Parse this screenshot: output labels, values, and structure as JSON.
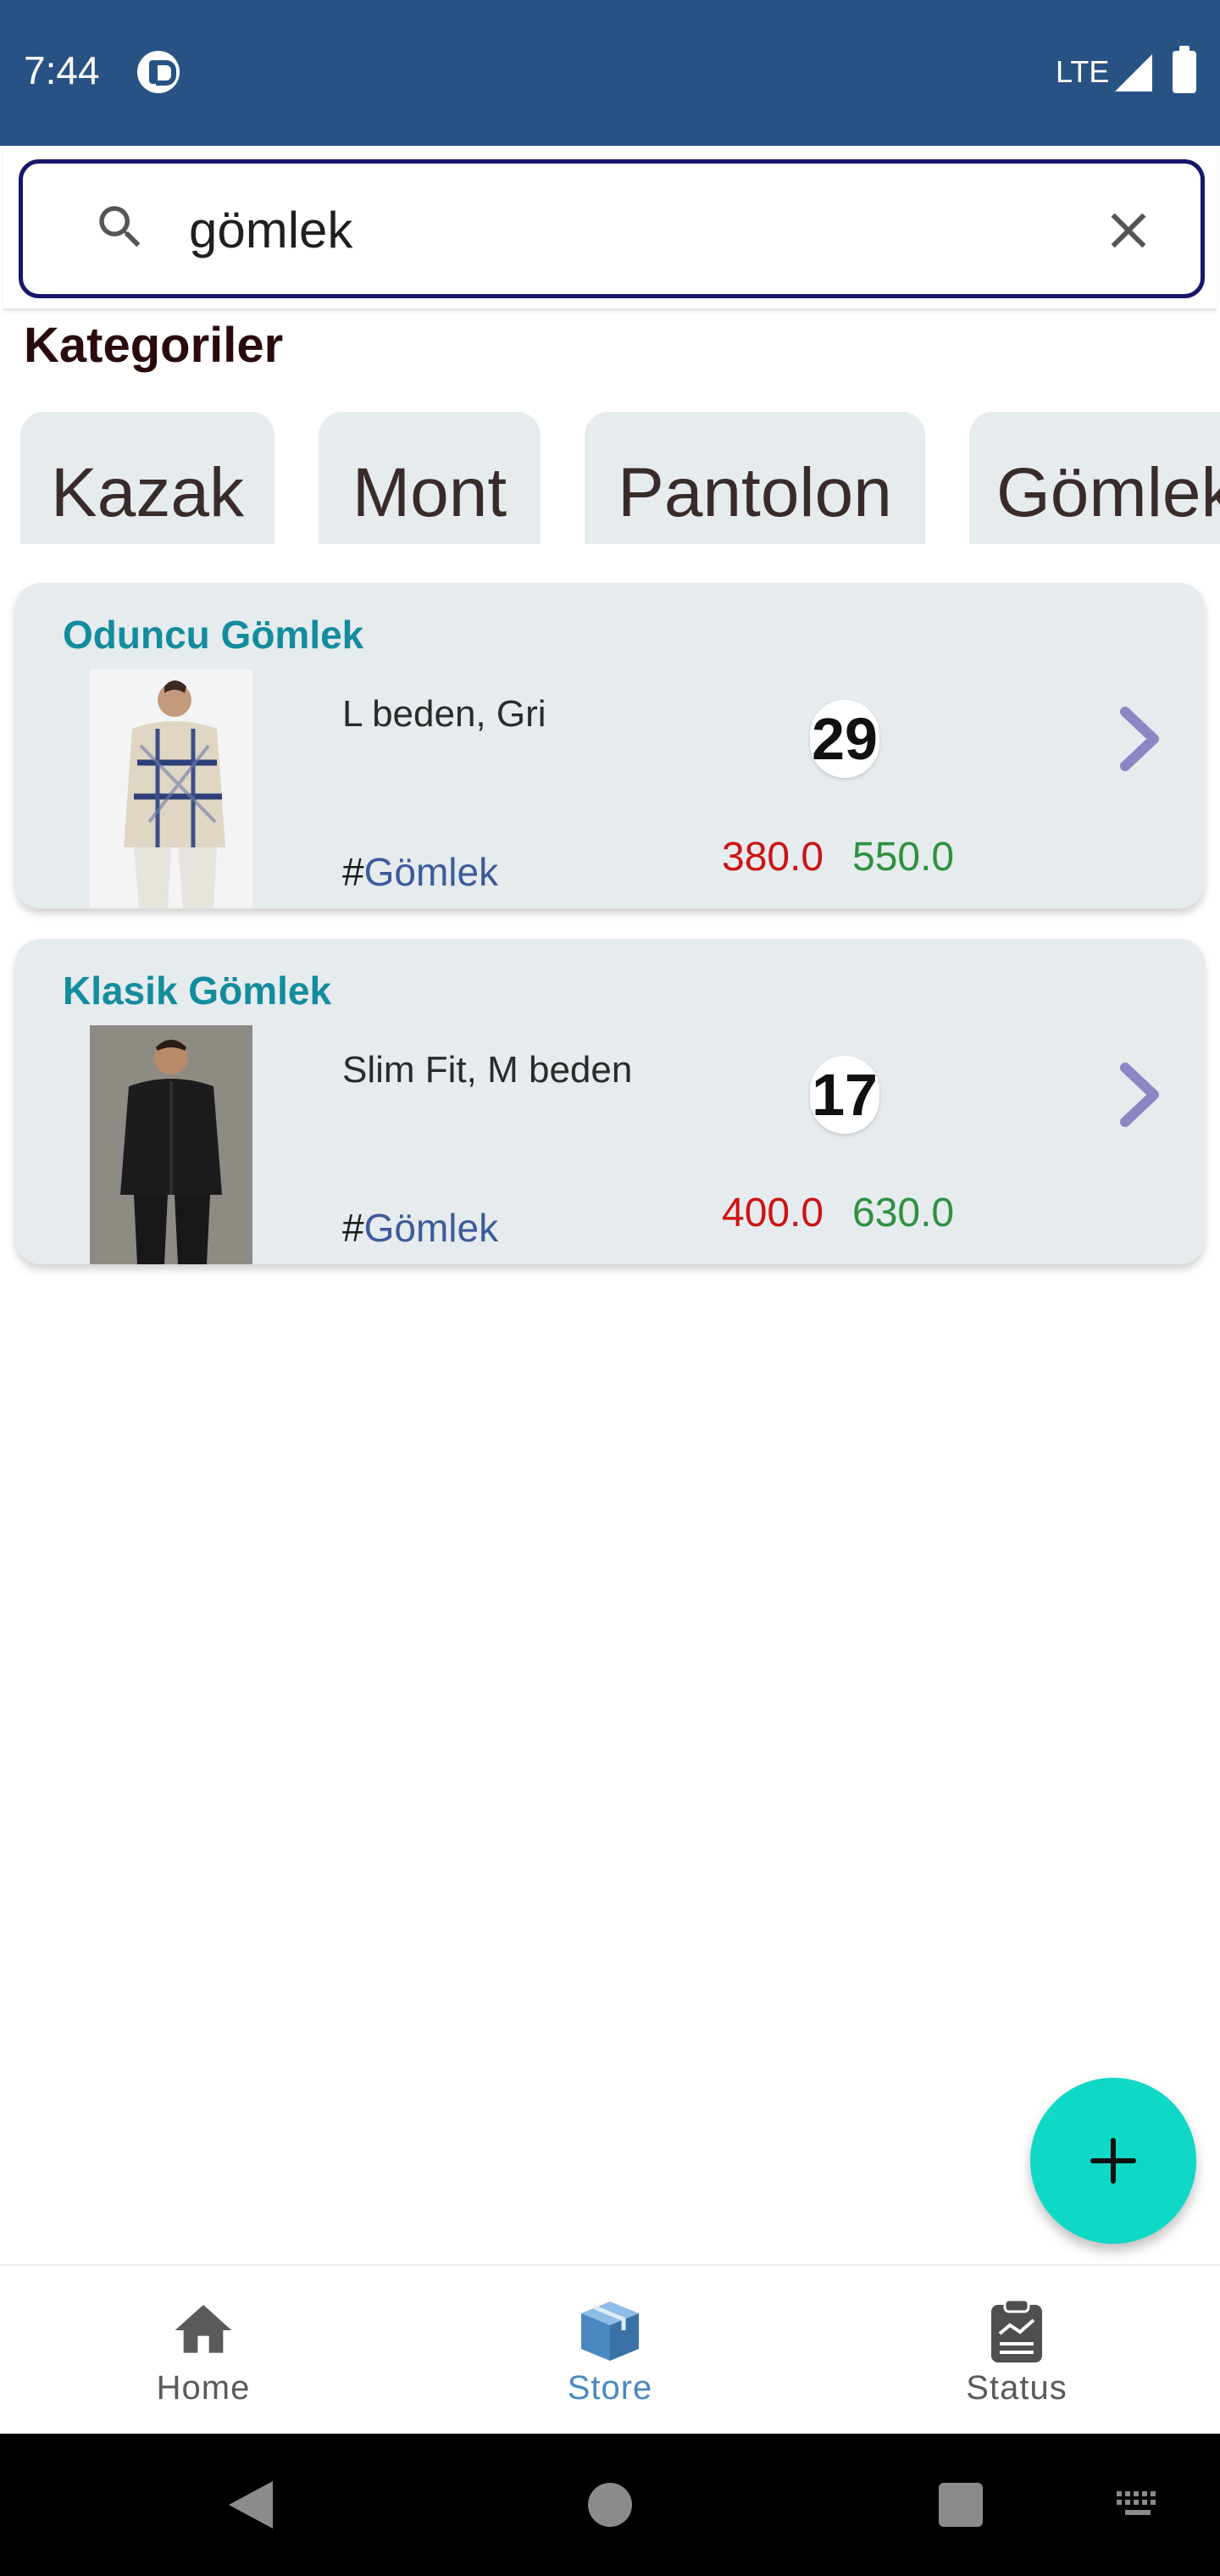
{
  "status_bar": {
    "time": "7:44",
    "network": "LTE",
    "icons": [
      "app-notification-icon",
      "signal-icon",
      "battery-icon"
    ],
    "background": "#285284"
  },
  "search": {
    "value": "gömlek",
    "placeholder": "",
    "border_color": "#16176a"
  },
  "categories": {
    "title": "Kategoriler",
    "items": [
      "Kazak",
      "Mont",
      "Pantolon",
      "Gömlek"
    ]
  },
  "products": [
    {
      "name": "Oduncu Gömlek",
      "description": "L beden, Gri",
      "quantity": "29",
      "tag_prefix": "#",
      "tag": "Gömlek",
      "buy_price": "380.0",
      "sell_price": "550.0"
    },
    {
      "name": "Klasik Gömlek",
      "description": "Slim Fit, M beden",
      "quantity": "17",
      "tag_prefix": "#",
      "tag": "Gömlek",
      "buy_price": "400.0",
      "sell_price": "630.0"
    }
  ],
  "fab": {
    "icon": "plus-icon",
    "color": "#0fd8c6"
  },
  "bottom_nav": {
    "items": [
      {
        "label": "Home",
        "icon": "home-icon",
        "active": false
      },
      {
        "label": "Store",
        "icon": "box-icon",
        "active": true
      },
      {
        "label": "Status",
        "icon": "clipboard-chart-icon",
        "active": false
      }
    ],
    "active_color": "#4a88c2"
  },
  "colors": {
    "card_background": "#e6ebee",
    "product_title": "#138c9e",
    "buy_price": "#cc1414",
    "sell_price": "#2e9140",
    "chevron": "#8a87c4"
  }
}
